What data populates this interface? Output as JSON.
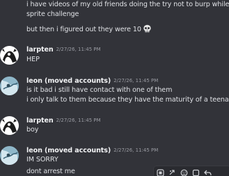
{
  "messages": [
    {
      "continued": true,
      "lines": [
        "i have videos of my old friends doing the try not to burp while ch",
        "sprite challenge",
        "but then i figured out they were 10"
      ],
      "trailing_emoji": "skull-emoji"
    },
    {
      "author": "larpten",
      "timestamp": "2/27/26, 11:45 PM",
      "lines": [
        "HEP"
      ]
    },
    {
      "author": "leon (moved accounts)",
      "timestamp": "2/27/26, 11:45 PM",
      "lines": [
        "is it bad i still have contact with one of them",
        "i only talk to them because they have the maturity of a teenager"
      ]
    },
    {
      "author": "larpten",
      "timestamp": "2/27/26, 11:45 PM",
      "lines": [
        "boy"
      ]
    },
    {
      "author": "leon (moved accounts)",
      "timestamp": "2/27/26, 11:45 PM",
      "lines": [
        "IM SORRY",
        "dont arrest me"
      ]
    }
  ],
  "hover_toolbar": {
    "icons": [
      "app-icon",
      "reaction-icon",
      "emoji-icon",
      "forward-icon",
      "reply-icon"
    ]
  },
  "colors": {
    "background": "#323339",
    "author": "#f2f3f5",
    "timestamp": "#9a9ca3",
    "text": "#dfe1e5"
  }
}
